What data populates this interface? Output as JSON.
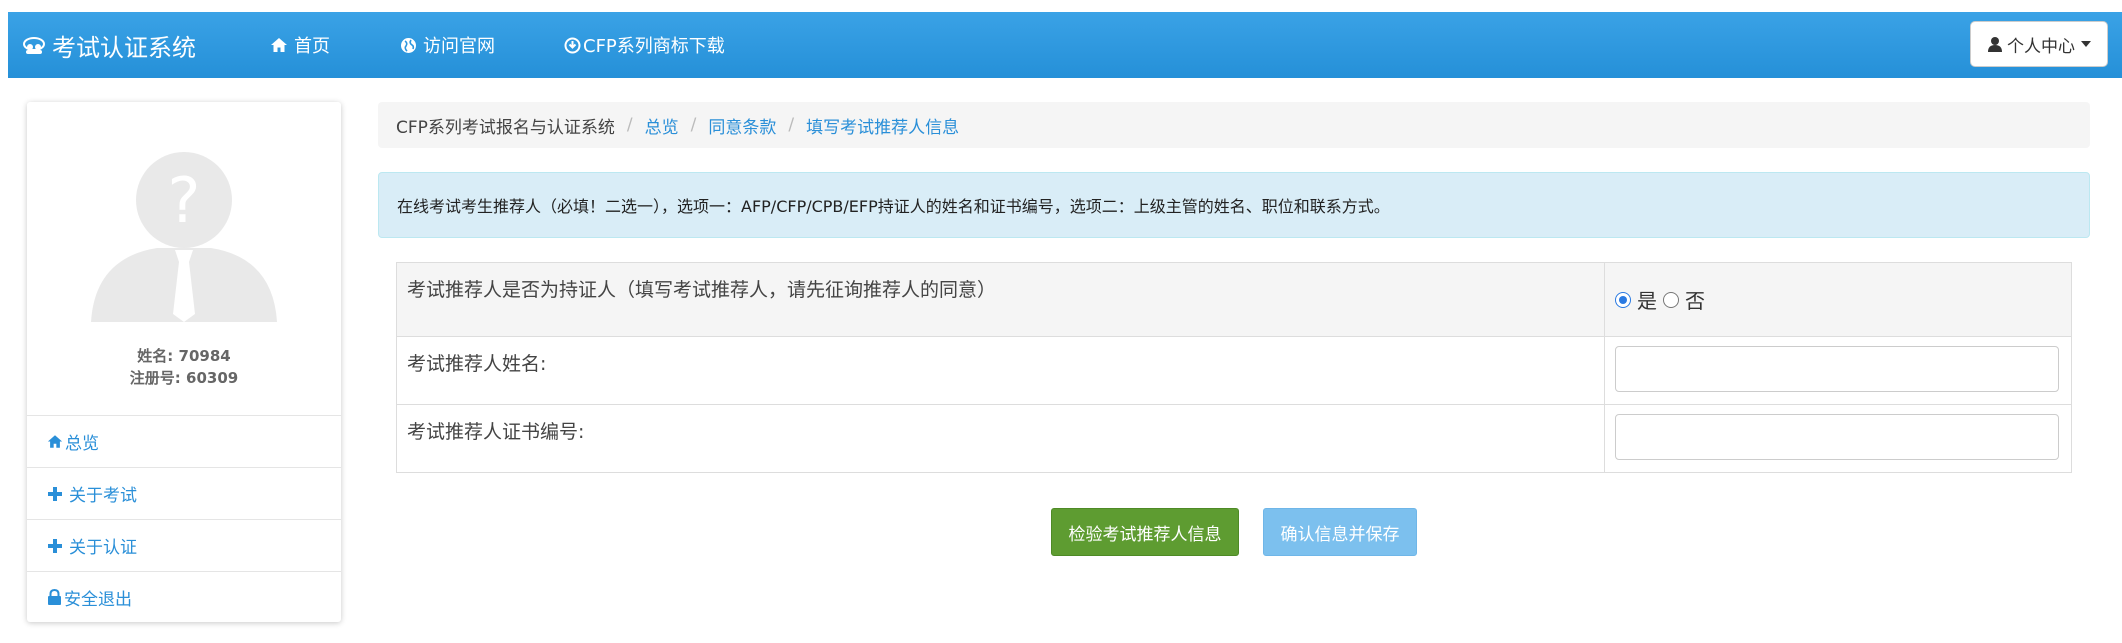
{
  "navbar": {
    "brand": "考试认证系统",
    "home": "首页",
    "visit_site": "访问官网",
    "download": "CFP系列商标下载",
    "user_center": "个人中心"
  },
  "profile": {
    "name": "姓名: 70984",
    "reg_no": "注册号: 60309"
  },
  "sidebar": {
    "items": [
      {
        "label": "总览"
      },
      {
        "label": "关于考试"
      },
      {
        "label": "关于认证"
      },
      {
        "label": "安全退出"
      }
    ]
  },
  "breadcrumb": {
    "items": [
      "CFP系列考试报名与认证系统",
      "总览",
      "同意条款",
      "填写考试推荐人信息"
    ]
  },
  "alert": {
    "text": "在线考试考生推荐人（必填！二选一），选项一：AFP/CFP/CPB/EFP持证人的姓名和证书编号，选项二：上级主管的姓名、职位和联系方式。"
  },
  "form": {
    "q_certified": "考试推荐人是否为持证人（填写考试推荐人，请先征询推荐人的同意）",
    "yes": "是",
    "no": "否",
    "selected": "是",
    "name_label": "考试推荐人姓名:",
    "name_value": "",
    "cert_label": "考试推荐人证书编号:",
    "cert_value": ""
  },
  "buttons": {
    "check": "检验考试推荐人信息",
    "save": "确认信息并保存"
  },
  "colors": {
    "navbar": "#2d97df",
    "link": "#2a8fd8",
    "alert_bg": "#d9edf7",
    "btn_check": "#5e9c31",
    "btn_save": "#7cc0ee"
  }
}
